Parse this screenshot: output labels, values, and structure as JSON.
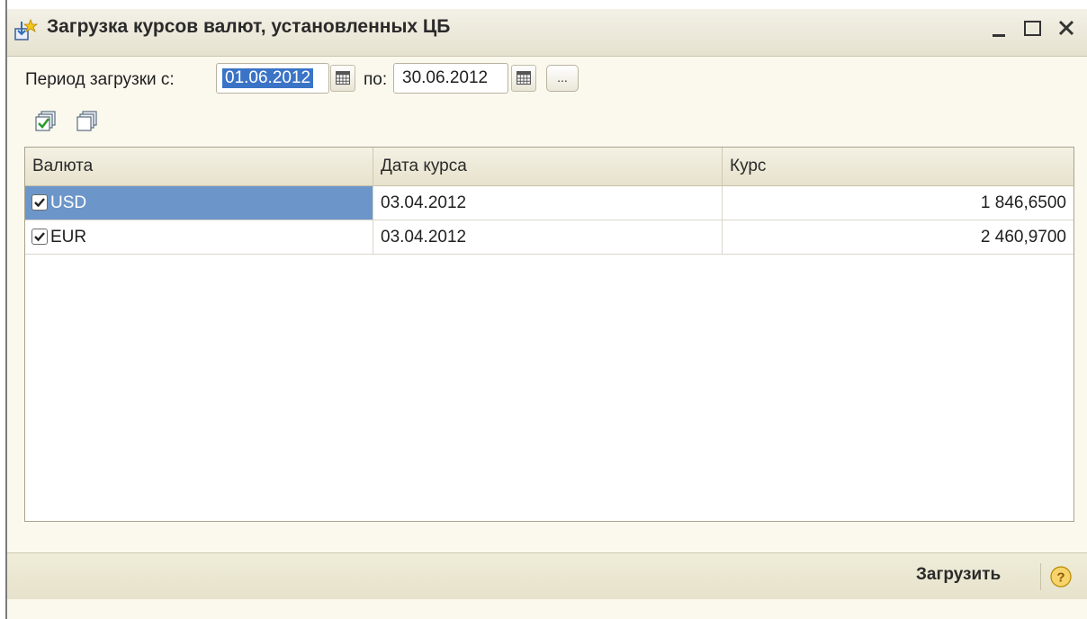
{
  "window": {
    "title": "Загрузка курсов валют, установленных ЦБ",
    "icons": {
      "app": "currency-load-icon",
      "minimize": "minimize-icon",
      "maximize": "maximize-icon",
      "close": "close-icon"
    }
  },
  "period": {
    "label": "Период загрузки с:",
    "from": "01.06.2012",
    "to_label": "по:",
    "to": "30.06.2012",
    "ellipsis": "..."
  },
  "toolbar": {
    "icons": [
      "check-all-icon",
      "uncheck-all-icon"
    ]
  },
  "table": {
    "columns": [
      "Валюта",
      "Дата курса",
      "Курс"
    ],
    "rows": [
      {
        "checked": true,
        "currency": "USD",
        "date": "03.04.2012",
        "rate": "1 846,6500"
      },
      {
        "checked": true,
        "currency": "EUR",
        "date": "03.04.2012",
        "rate": "2 460,9700"
      }
    ]
  },
  "footer": {
    "load_label": "Загрузить",
    "help_icon": "help-icon"
  },
  "colors": {
    "selection": "#3b74c6",
    "row_highlight": "#6c96c9",
    "panel_bg": "#fbf9ee",
    "footer_bg": "#e6e2cb"
  }
}
